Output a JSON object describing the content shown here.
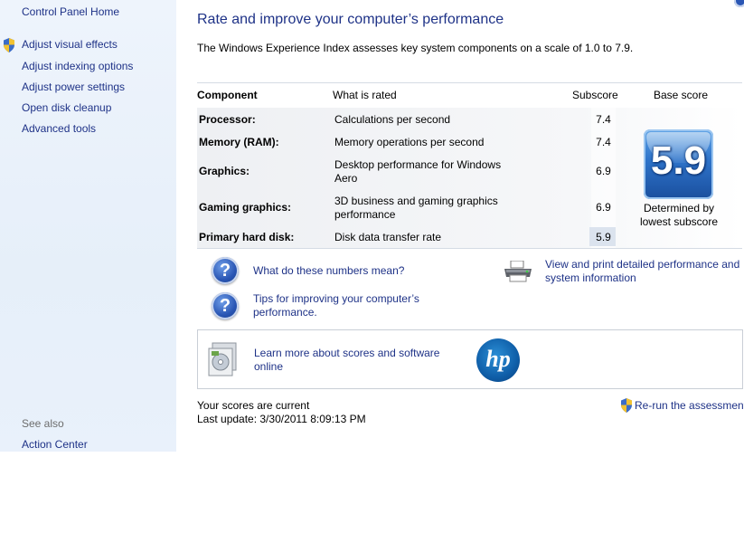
{
  "left_pane": {
    "control_panel_home": "Control Panel Home",
    "tasks": [
      "Adjust visual effects",
      "Adjust indexing options",
      "Adjust power settings",
      "Open disk cleanup",
      "Advanced tools"
    ],
    "see_also_label": "See also",
    "see_also_links": [
      "Action Center"
    ]
  },
  "main": {
    "title": "Rate and improve your computer’s performance",
    "description": "The Windows Experience Index assesses key system components on a scale of 1.0 to 7.9.",
    "table": {
      "headers": {
        "component": "Component",
        "what": "What is rated",
        "subscore": "Subscore",
        "base": "Base score"
      },
      "rows": [
        {
          "component": "Processor:",
          "what": "Calculations per second",
          "subscore": "7.4"
        },
        {
          "component": "Memory (RAM):",
          "what": "Memory operations per second",
          "subscore": "7.4"
        },
        {
          "component": "Graphics:",
          "what": "Desktop performance for Windows Aero",
          "subscore": "6.9"
        },
        {
          "component": "Gaming graphics:",
          "what": "3D business and gaming graphics performance",
          "subscore": "6.9"
        },
        {
          "component": "Primary hard disk:",
          "what": "Disk data transfer rate",
          "subscore": "5.9"
        }
      ],
      "base_score": "5.9",
      "base_caption": "Determined by lowest subscore"
    },
    "links": {
      "what_numbers": "What do these numbers mean?",
      "tips": "Tips for improving your computer’s performance.",
      "view_print": "View and print detailed performance and system information"
    },
    "promo": {
      "text": "Learn more about scores and software online",
      "brand": "hp"
    },
    "status_current": "Your scores are current",
    "last_update": "Last update: 3/30/2011 8:09:13 PM",
    "rerun": "Re-run the assessment"
  },
  "icons": {
    "question": "help-question-icon",
    "printer": "printer-icon",
    "shield": "uac-shield-icon",
    "software": "software-box-icon",
    "hp": "hp-logo-icon"
  },
  "colors": {
    "link": "#1e3287",
    "accent": "#2e73c9",
    "left_pane": "#e9f1fb"
  }
}
